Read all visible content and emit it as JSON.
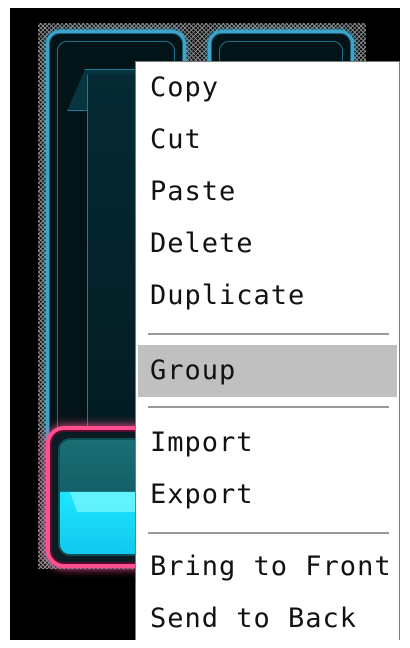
{
  "context_menu": {
    "items": [
      {
        "label": "Copy"
      },
      {
        "label": "Cut"
      },
      {
        "label": "Paste"
      },
      {
        "label": "Delete"
      },
      {
        "label": "Duplicate"
      },
      {
        "label": "Group",
        "highlighted": true
      },
      {
        "label": "Import"
      },
      {
        "label": "Export"
      },
      {
        "label": "Bring to Front"
      },
      {
        "label": "Send to Back"
      }
    ]
  },
  "colors": {
    "panel_border": "#3aa6cc",
    "knob_border": "#ff4f8e",
    "knob_fill": "#1ee6ff",
    "menu_highlight": "#c0c0c0"
  }
}
